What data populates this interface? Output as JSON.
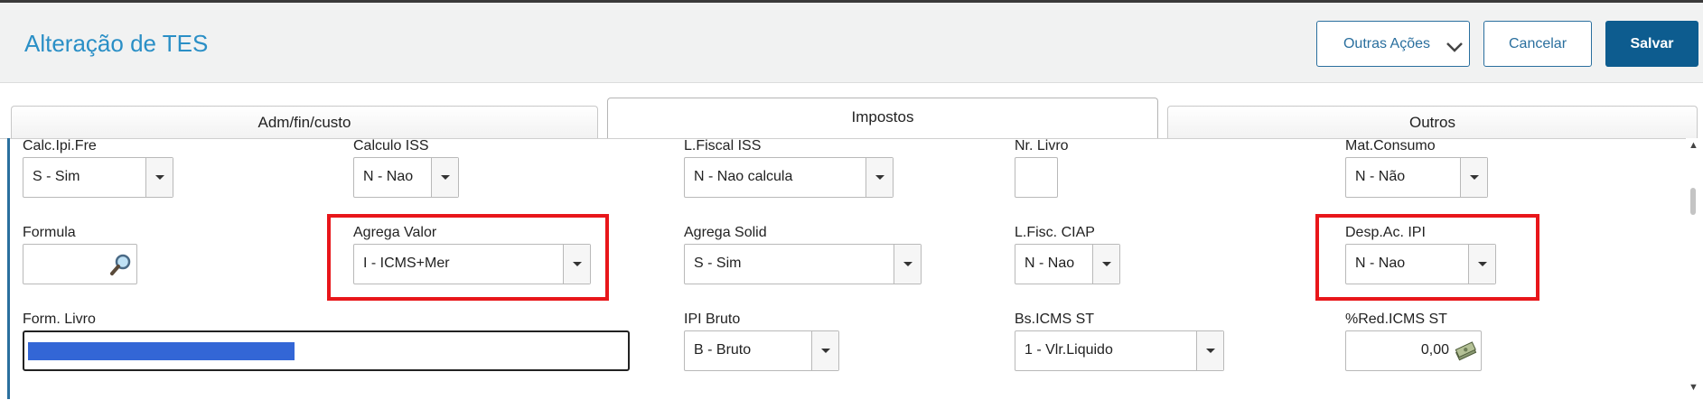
{
  "header": {
    "title": "Alteração de TES",
    "buttons": {
      "outras": "Outras Ações",
      "cancelar": "Cancelar",
      "salvar": "Salvar"
    }
  },
  "tabs": [
    {
      "label": "Adm/fin/custo"
    },
    {
      "label": "Impostos"
    },
    {
      "label": "Outros"
    }
  ],
  "fields": {
    "calc_ipi_fre": {
      "label": "Calc.Ipi.Fre",
      "value": "S - Sim"
    },
    "calculo_iss": {
      "label": "Calculo ISS",
      "value": "N - Nao"
    },
    "lfiscal_iss": {
      "label": "L.Fiscal ISS",
      "value": "N - Nao calcula"
    },
    "nr_livro": {
      "label": "Nr. Livro",
      "value": ""
    },
    "mat_consumo": {
      "label": "Mat.Consumo",
      "value": "N - Não"
    },
    "formula": {
      "label": "Formula",
      "value": ""
    },
    "agrega_valor": {
      "label": "Agrega Valor",
      "value": "I - ICMS+Mer"
    },
    "agrega_solid": {
      "label": "Agrega Solid",
      "value": "S - Sim"
    },
    "lfisc_ciap": {
      "label": "L.Fisc. CIAP",
      "value": "N - Nao"
    },
    "desp_ac_ipi": {
      "label": "Desp.Ac. IPI",
      "value": "N - Nao"
    },
    "form_livro": {
      "label": "Form. Livro",
      "value": ""
    },
    "ipi_bruto": {
      "label": "IPI Bruto",
      "value": "B - Bruto"
    },
    "bs_icms_st": {
      "label": "Bs.ICMS ST",
      "value": "1 - Vlr.Liquido"
    },
    "red_icms_st": {
      "label": "%Red.ICMS ST",
      "value": "0,00"
    }
  },
  "colors": {
    "title": "#2a8fc6",
    "primary": "#0d5c8f",
    "highlight": "#e8161a",
    "selection": "#3366d6"
  },
  "icons": {
    "chevron": "chevron-down-icon",
    "search": "magnifier-icon",
    "money": "money-icon"
  }
}
